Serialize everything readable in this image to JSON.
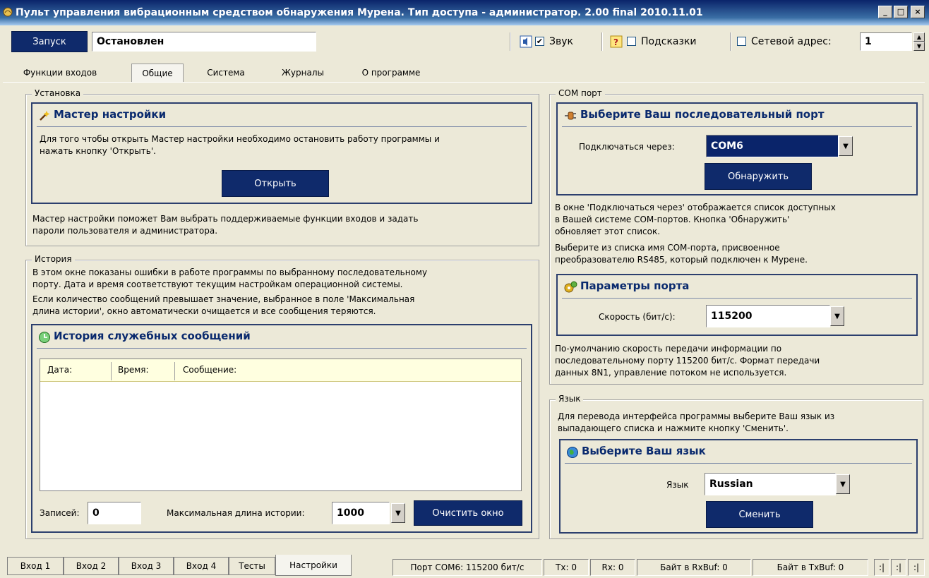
{
  "window": {
    "title": "Пульт управления вибрационным средством обнаружения Мурена. Тип доступа - администратор. 2.00 final 2010.11.01",
    "minimize": "_",
    "maximize": "□",
    "close": "×"
  },
  "toolbar": {
    "start_label": "Запуск",
    "status_value": "Остановлен",
    "sound_label": "Звук",
    "sound_checked": "✔",
    "hints_label": "Подсказки",
    "net_address_label": "Сетевой адрес:",
    "net_address_value": "1"
  },
  "tabs": [
    "Функции входов",
    "Общие",
    "Система",
    "Журналы",
    "О программе"
  ],
  "install": {
    "group_title": "Установка",
    "panel_title": "Мастер настройки",
    "text1": "Для того чтобы открыть Мастер настройки необходимо остановить работу программы и",
    "text2": "нажать кнопку 'Открыть'.",
    "open_button": "Открыть",
    "note1": "Мастер настройки поможет Вам выбрать поддерживаемые функции входов и задать",
    "note2": "пароли пользователя и администратора."
  },
  "history": {
    "group_title": "История",
    "text1": "В этом окне показаны ошибки в работе программы по выбранному последовательному",
    "text2": "порту. Дата и время соответствуют текущим настройкам операционной системы.",
    "text3": "Если количество сообщений превышает значение, выбранное в поле 'Максимальная",
    "text4": "длина истории', окно автоматически очищается и все сообщения теряются.",
    "panel_title": "История служебных сообщений",
    "columns": [
      "Дата:",
      "Время:",
      "Сообщение:"
    ],
    "records_label": "Записей:",
    "records_value": "0",
    "max_len_label": "Максимальная длина истории:",
    "max_len_value": "1000",
    "clear_button": "Очистить окно"
  },
  "com": {
    "group_title": "COM порт",
    "panel_title": "Выберите Ваш последовательный порт",
    "connect_label": "Подключаться через:",
    "connect_value": "COM6",
    "detect_button": "Обнаружить",
    "text1": "В окне 'Подключаться через' отображается список доступных",
    "text2": "в Вашей системе COM-портов. Кнопка 'Обнаружить'",
    "text3": "обновляет этот список.",
    "text4": "Выберите из списка имя COM-порта, присвоенное",
    "text5": "преобразователю RS485, который подключен к Мурене.",
    "params_title": "Параметры порта",
    "speed_label": "Скорость (бит/с):",
    "speed_value": "115200",
    "note1": "По-умолчанию скорость передачи информации по",
    "note2": "последовательному порту 115200 бит/с. Формат передачи",
    "note3": "данных 8N1, управление потоком не используется."
  },
  "lang": {
    "group_title": "Язык",
    "text1": "Для перевода интерфейса программы выберите Ваш язык из",
    "text2": "выпадающего списка и нажмите кнопку 'Сменить'.",
    "panel_title": "Выберите Ваш язык",
    "lang_label": "Язык",
    "lang_value": "Russian",
    "change_button": "Сменить"
  },
  "bottom_tabs": [
    "Вход 1",
    "Вход 2",
    "Вход 3",
    "Вход 4",
    "Тесты",
    "Настройки"
  ],
  "statusbar": {
    "port": "Порт COM6: 115200 бит/с",
    "tx": "Tx: 0",
    "rx": "Rx: 0",
    "rxbuf": "Байт в RxBuf: 0",
    "txbuf": "Байт в TxBuf: 0",
    "p1": ":|",
    "p2": ":|",
    "p3": ":|"
  },
  "colors": {
    "accent": "#0f2a6b",
    "panel_title": "#0a2a6e",
    "table_header": "#ffffe0"
  }
}
